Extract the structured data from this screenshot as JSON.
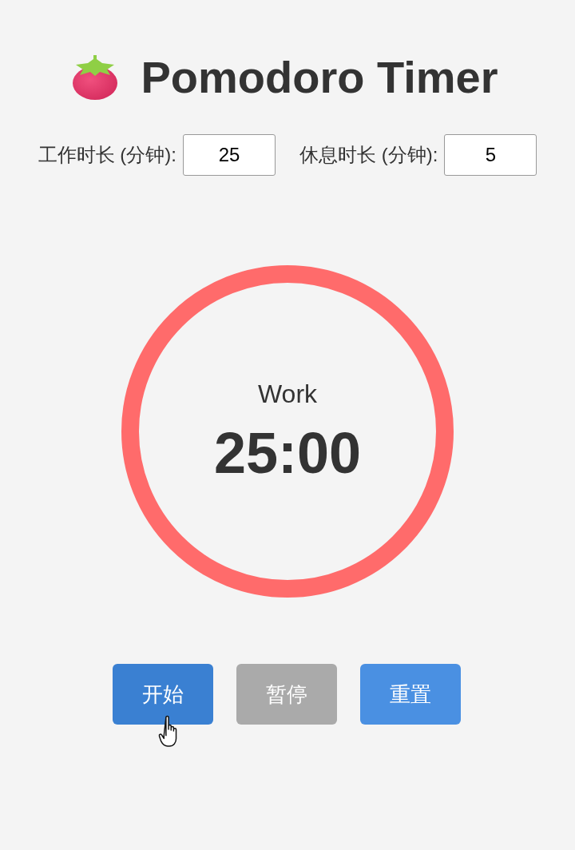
{
  "title": {
    "text": "Pomodoro Timer"
  },
  "settings": [
    {
      "label": "工作时长 (分钟):",
      "value": "25"
    },
    {
      "label": "休息时长 (分钟):",
      "value": "5"
    }
  ],
  "timer": {
    "mode": "Work",
    "time": "25:00",
    "level": 1
  },
  "buttons": [
    {
      "label": "开始",
      "disabled": false,
      "hovered": true
    },
    {
      "label": "暂停",
      "disabled": true,
      "hovered": false
    },
    {
      "label": "重置",
      "disabled": false,
      "hovered": false
    }
  ]
}
